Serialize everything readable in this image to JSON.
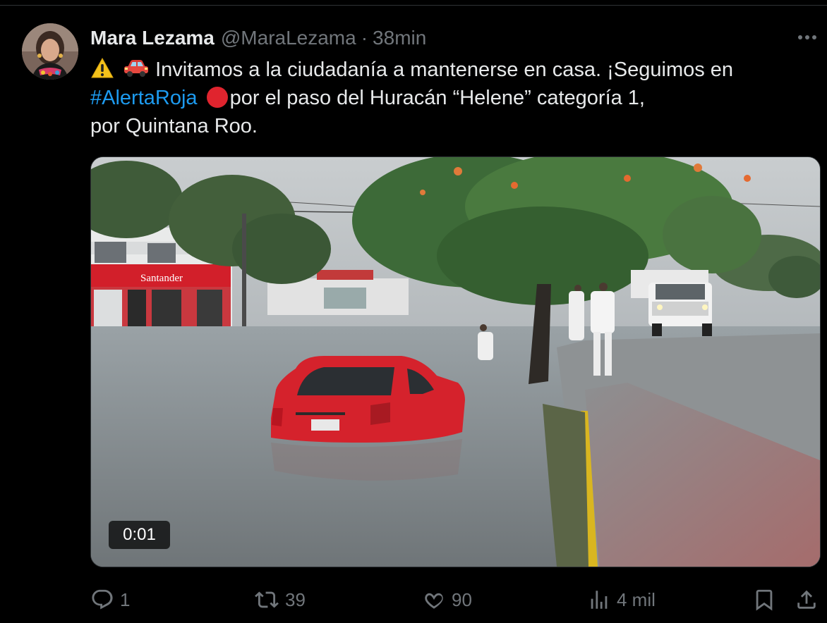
{
  "tweet": {
    "author_name": "Mara Lezama",
    "author_handle": "@MaraLezama",
    "separator": "·",
    "time": "38min",
    "text_part1": " Invitamos a la ciudadanía a mantenerse en casa. ¡Seguimos en",
    "hashtag": "#AlertaRoja",
    "text_part2": "por el paso del Huracán “Helene” categoría 1,",
    "text_part3": "por Quintana Roo.",
    "emojis": [
      "warning-sign",
      "red-car",
      "red-circle"
    ]
  },
  "media": {
    "type": "video",
    "duration": "0:01",
    "storefront_sign": "Santander"
  },
  "actions": {
    "replies": "1",
    "retweets": "39",
    "likes": "90",
    "views": "4 mil"
  },
  "colors": {
    "background": "#000000",
    "text": "#e7e9ea",
    "secondary": "#71767b",
    "link": "#1d9bf0"
  }
}
